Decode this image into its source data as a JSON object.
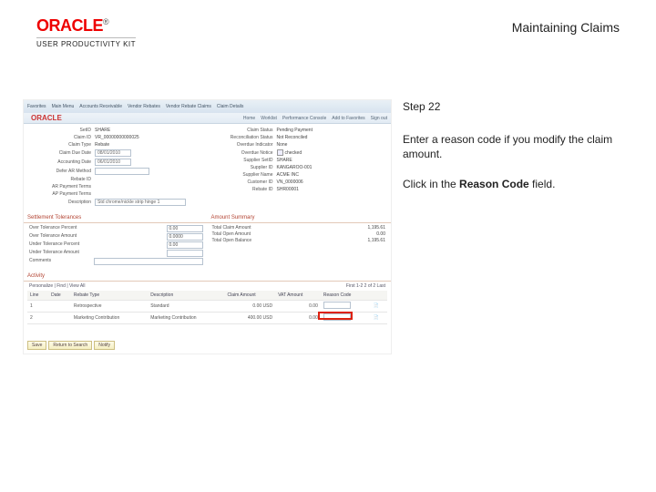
{
  "header": {
    "brand": "ORACLE",
    "trademark": "®",
    "product_line": "USER PRODUCTIVITY KIT",
    "page_title": "Maintaining Claims"
  },
  "instructions": {
    "step_label": "Step 22",
    "line1": "Enter a reason code if you modify the claim amount.",
    "line2_pre": "Click in the ",
    "line2_bold": "Reason Code",
    "line2_post": " field."
  },
  "screenshot": {
    "breadcrumb": [
      "Favorites",
      "Main Menu",
      "Accounts Receivable",
      "Vendor Rebates",
      "Vendor Rebate Claims",
      "Claim Details"
    ],
    "top_tabs": [
      "Home",
      "Worklist",
      "Performance Console",
      "Add to Favorites",
      "Sign out"
    ],
    "app_logo": "ORACLE",
    "form_left": [
      {
        "label": "SetID",
        "value": "SHARE"
      },
      {
        "label": "Claim ID",
        "value": "VR_00000000000025"
      },
      {
        "label": "Claim Type",
        "value": "Rebate"
      },
      {
        "label": "Claim Due Date",
        "value": "08/01/2010"
      },
      {
        "label": "Accounting Date",
        "value": "06/01/2010"
      },
      {
        "label": "Defer AR Method",
        "value": ""
      },
      {
        "label": "Rebate ID",
        "value": ""
      },
      {
        "label": "AR Payment Terms",
        "value": ""
      },
      {
        "label": "AP Payment Terms",
        "value": ""
      },
      {
        "label": "Description",
        "value": "Std chrome/nickle strip hinge 1"
      }
    ],
    "form_right": [
      {
        "label": "Claim Status",
        "value": "Pending Payment"
      },
      {
        "label": "Reconciliation Status",
        "value": "Not Reconciled"
      },
      {
        "label": "Overdue Indicator",
        "value": "None"
      },
      {
        "label": "Overdue Notice",
        "value": "checked"
      },
      {
        "label": "Supplier SetID",
        "value": "SHARE"
      },
      {
        "label": "Supplier ID",
        "value": "KANGAROO-001"
      },
      {
        "label": "Supplier Name",
        "value": "ACME INC"
      },
      {
        "label": "Customer ID",
        "value": "VN_0000006"
      },
      {
        "label": "Rebate ID",
        "value": "SHR00001"
      }
    ],
    "sections": {
      "tolerance_header": "Settlement Tolerances",
      "amount_header": "Amount Summary"
    },
    "tolerance_rows": [
      {
        "label": "Over Tolerance Percent",
        "value": "0.00"
      },
      {
        "label": "Over Tolerance Amount",
        "value": "0.0000"
      },
      {
        "label": "Under Tolerance Percent",
        "value": "0.00"
      },
      {
        "label": "Under Tolerance Amount",
        "value": ""
      },
      {
        "label": "Comments",
        "value": ""
      }
    ],
    "amount_rows": [
      {
        "label": "Total Claim Amount",
        "value": "1,195.61"
      },
      {
        "label": "Total Open Amount",
        "value": "0.00"
      },
      {
        "label": "Total Open Balance",
        "value": "1,195.61"
      }
    ],
    "activity": {
      "header": "Activity",
      "find_label": "Personalize | Find | View All",
      "count_label": "First 1-2 2 of 2 Last",
      "columns": [
        "Line",
        "Date",
        "Rebate Type",
        "Description",
        "Claim Amount",
        "VAT Amount",
        "Reason Code",
        ""
      ],
      "rows": [
        {
          "line": "1",
          "date": "",
          "type": "Retrospective",
          "desc": "Standard",
          "amount": "0.00 USD",
          "vat": "0.00",
          "reason": "",
          "icon": "scroll"
        },
        {
          "line": "2",
          "date": "",
          "type": "Marketing Contribution",
          "desc": "Marketing Contribution",
          "amount": "400.00 USD",
          "vat": "0.00",
          "reason": "",
          "icon": "scroll"
        }
      ]
    },
    "footer_buttons": [
      "Save",
      "Return to Search",
      "Notify"
    ]
  }
}
